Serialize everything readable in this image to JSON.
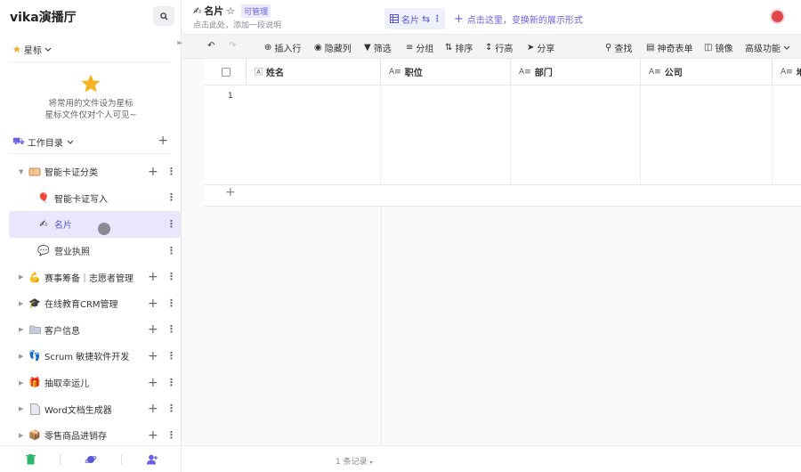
{
  "sidebar": {
    "space_name": "vika演播厅",
    "star_section": "星标",
    "star_empty_line1": "将常用的文件设为星标",
    "star_empty_line2": "星标文件仅对个人可见~",
    "catalog_title": "工作目录",
    "items": [
      {
        "label": "智能卡证分类",
        "icon": "ticket-icon",
        "level": 0,
        "expanded": true
      },
      {
        "label": "智能卡证写入",
        "icon": "balloon-icon",
        "level": 1
      },
      {
        "label": "名片",
        "icon": "writing-hand-icon",
        "level": 1,
        "active": true
      },
      {
        "label": "营业执照",
        "icon": "speech-bubble-icon",
        "level": 1
      },
      {
        "label": "赛事筹备｜志愿者管理",
        "icon": "flexed-arm-icon",
        "level": 0
      },
      {
        "label": "在线教育CRM管理",
        "icon": "grad-cap-icon",
        "level": 0
      },
      {
        "label": "客户信息",
        "icon": "folder-icon",
        "level": 0
      },
      {
        "label": "Scrum 敏捷软件开发",
        "icon": "footprints-icon",
        "level": 0
      },
      {
        "label": "抽取幸运儿",
        "icon": "gift-icon",
        "level": 0
      },
      {
        "label": "Word文档生成器",
        "icon": "document-icon",
        "level": 0
      },
      {
        "label": "零售商品进销存",
        "icon": "box-icon",
        "level": 0
      }
    ]
  },
  "sheet": {
    "title": "名片",
    "permission": "可管理",
    "description": "点击此处，添加一段说明",
    "view_name": "名片",
    "add_view_hint": "点击这里，变换新的展示形式"
  },
  "toolbar": {
    "insert_row": "插入行",
    "hide_columns": "隐藏列",
    "filter": "筛选",
    "group": "分组",
    "sort": "排序",
    "row_height": "行高",
    "share": "分享",
    "find": "查找",
    "form": "神奇表单",
    "mirror": "镜像",
    "advanced": "高级功能"
  },
  "grid": {
    "columns": [
      "姓名",
      "职位",
      "部门",
      "公司",
      "地"
    ],
    "rows": [
      {
        "number": "1"
      }
    ],
    "record_count": "1 条记录"
  },
  "colors": {
    "accent": "#6a5ee6",
    "active_bg": "#e9e7fb"
  }
}
